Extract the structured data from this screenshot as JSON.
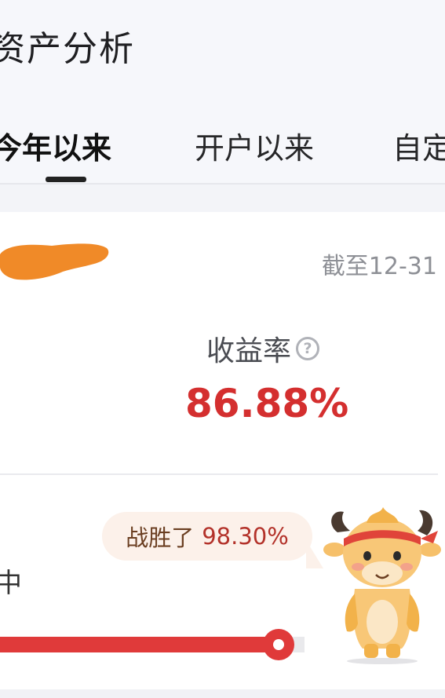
{
  "header": {
    "title": "资产分析",
    "tabs": [
      {
        "label": "今年以来",
        "active": true
      },
      {
        "label": "开户以来",
        "active": false
      },
      {
        "label": "自定",
        "active": false
      }
    ]
  },
  "card": {
    "as_of": "截至12-31",
    "metric": {
      "label": "收益率",
      "value": "86.88%",
      "value_color": "#d42f2f",
      "help_icon": "question-circle-icon"
    },
    "ranking": {
      "bubble_prefix": "战胜了",
      "bubble_value": "98.30%",
      "label": "中",
      "percent": 98.3
    },
    "mascot_icon": "ox-mascot-icon"
  }
}
